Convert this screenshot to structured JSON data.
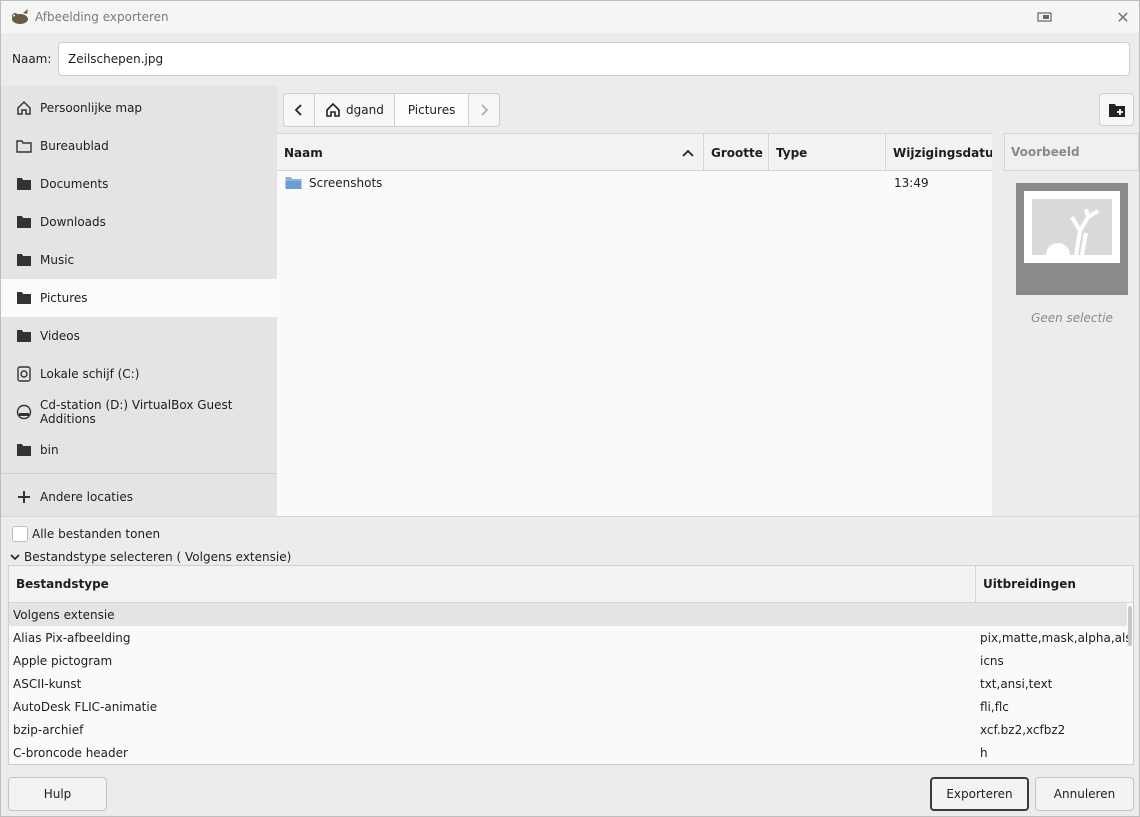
{
  "window": {
    "title": "Afbeelding exporteren"
  },
  "name_row": {
    "label": "Naam:",
    "value": "Zeilschepen.jpg"
  },
  "sidebar": {
    "items": [
      {
        "label": "Persoonlijke map",
        "icon": "home-icon"
      },
      {
        "label": "Bureaublad",
        "icon": "folder-icon"
      },
      {
        "label": "Documents",
        "icon": "folder-icon"
      },
      {
        "label": "Downloads",
        "icon": "folder-icon"
      },
      {
        "label": "Music",
        "icon": "folder-icon"
      },
      {
        "label": "Pictures",
        "icon": "folder-icon",
        "active": true
      },
      {
        "label": "Videos",
        "icon": "folder-icon"
      },
      {
        "label": "Lokale schijf (C:)",
        "icon": "drive-icon"
      },
      {
        "label": "Cd-station (D:) VirtualBox Guest Additions",
        "icon": "optical-drive-icon"
      },
      {
        "label": "bin",
        "icon": "folder-icon"
      }
    ],
    "other_locations": "Andere locaties"
  },
  "pathbar": {
    "segments": [
      "dgand",
      "Pictures"
    ]
  },
  "file_list": {
    "columns": [
      "Naam",
      "Grootte",
      "Type",
      "Wijzigingsdatum"
    ],
    "rows": [
      {
        "name": "Screenshots",
        "size": "",
        "type": "",
        "modified": "13:49"
      }
    ]
  },
  "preview": {
    "header": "Voorbeeld",
    "caption": "Geen selectie"
  },
  "show_all_files": "Alle bestanden tonen",
  "filetype_expander": "Bestandstype selecteren ( Volgens extensie)",
  "filetype_table": {
    "columns": [
      "Bestandstype",
      "Uitbreidingen"
    ],
    "rows": [
      {
        "type": "Volgens extensie",
        "ext": ""
      },
      {
        "type": "Alias Pix-afbeelding",
        "ext": "pix,matte,mask,alpha,als"
      },
      {
        "type": "Apple pictogram",
        "ext": "icns"
      },
      {
        "type": "ASCII-kunst",
        "ext": "txt,ansi,text"
      },
      {
        "type": "AutoDesk FLIC-animatie",
        "ext": "fli,flc"
      },
      {
        "type": "bzip-archief",
        "ext": "xcf.bz2,xcfbz2"
      },
      {
        "type": "C-broncode header",
        "ext": "h"
      }
    ]
  },
  "buttons": {
    "help": "Hulp",
    "export": "Exporteren",
    "cancel": "Annuleren"
  }
}
